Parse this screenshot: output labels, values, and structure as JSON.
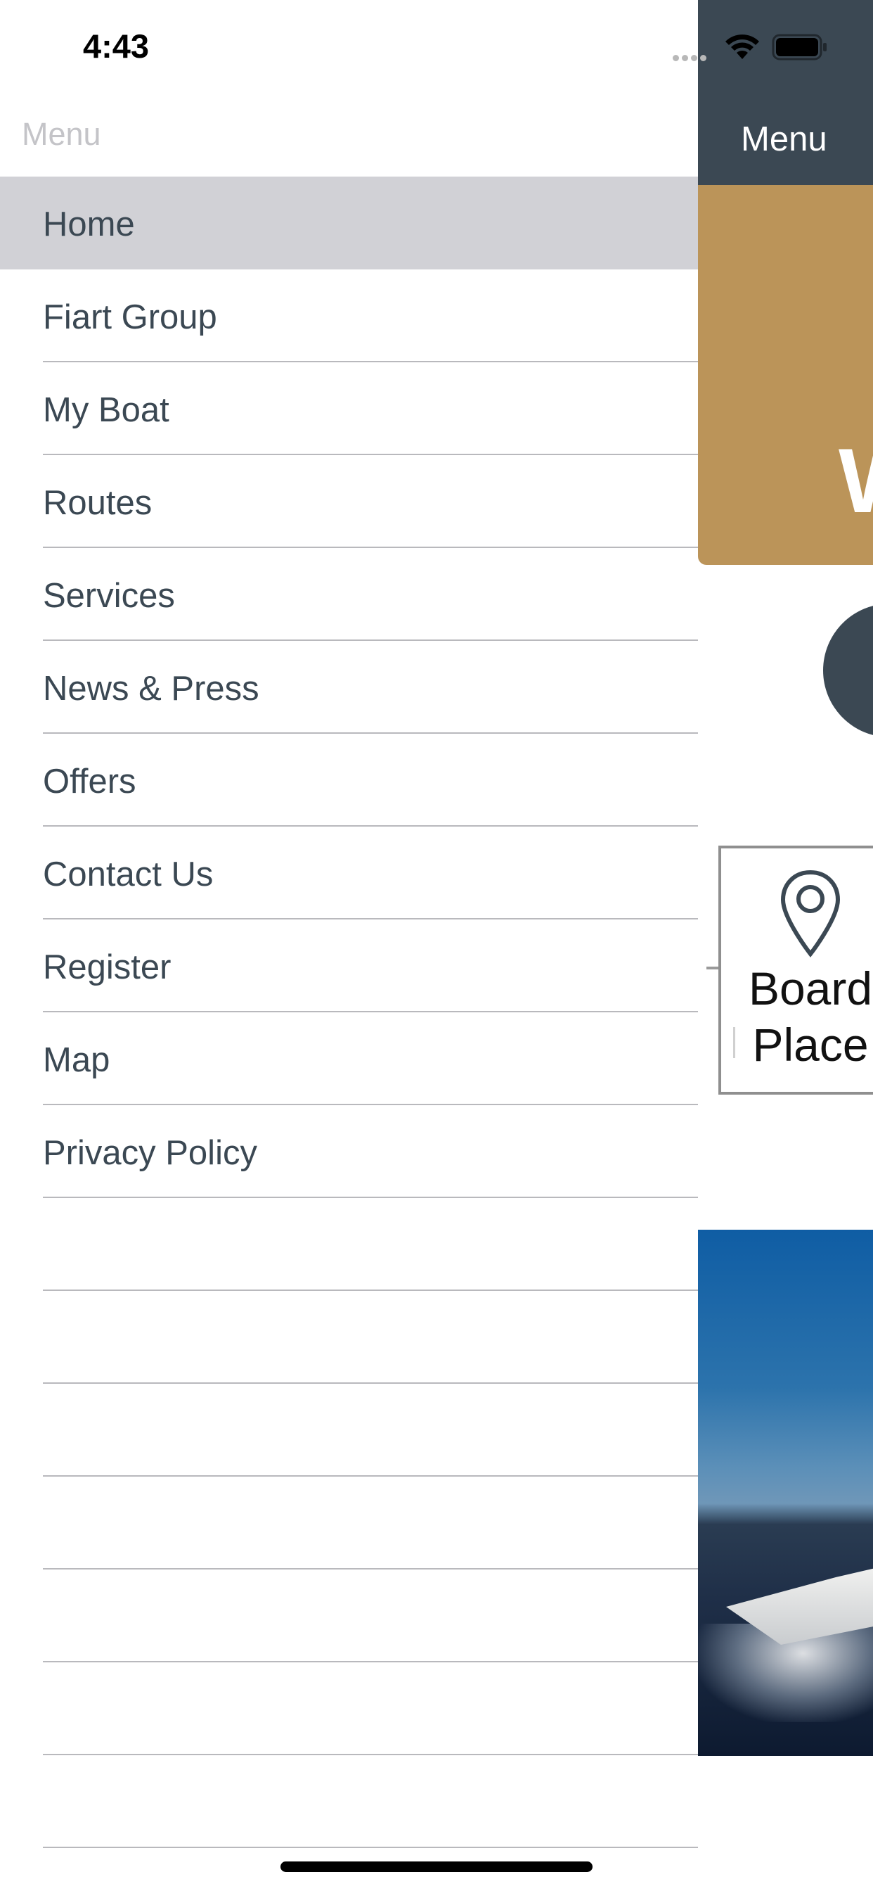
{
  "status_bar": {
    "time": "4:43"
  },
  "menu": {
    "header": "Menu",
    "items": [
      {
        "label": "Home",
        "selected": true
      },
      {
        "label": "Fiart Group"
      },
      {
        "label": "My Boat"
      },
      {
        "label": "Routes"
      },
      {
        "label": "Services"
      },
      {
        "label": "News & Press"
      },
      {
        "label": "Offers"
      },
      {
        "label": "Contact Us"
      },
      {
        "label": "Register"
      },
      {
        "label": "Map"
      },
      {
        "label": "Privacy Policy"
      }
    ]
  },
  "background_app": {
    "nav_title": "Menu",
    "banner_text": "W",
    "boarding_card": {
      "line1": "Board",
      "line2": "Place",
      "icon": "location-pin-icon"
    }
  },
  "colors": {
    "nav_bar": "#3b4853",
    "banner_gold": "#bb9459",
    "menu_selected": "#d1d1d6",
    "menu_text": "#3b4853"
  }
}
